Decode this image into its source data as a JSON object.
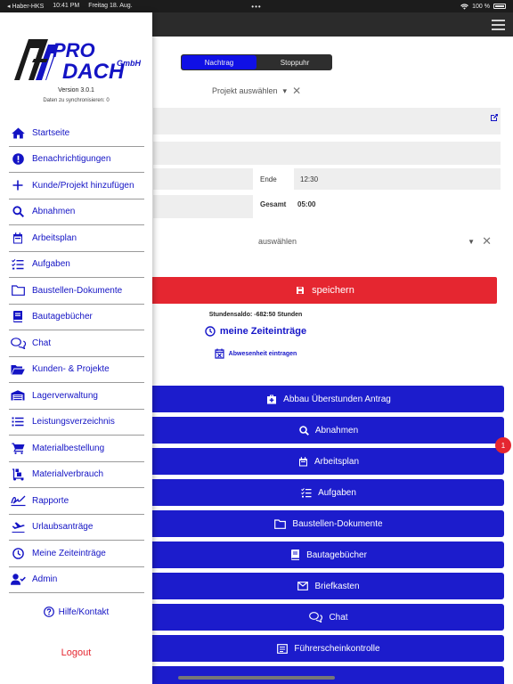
{
  "status": {
    "carrier": "◂ Haber-HKS",
    "time": "10:41 PM",
    "date": "Freitag 18. Aug.",
    "dots": "•••",
    "battery": "100 %"
  },
  "main": {
    "segment": {
      "tab1": "Nachtrag",
      "tab2": "Stoppuhr"
    },
    "project_select": "Projekt auswählen",
    "ende_label": "Ende",
    "ende_value": "12:30",
    "gesamt_label": "Gesamt",
    "gesamt_value": "05:00",
    "select_placeholder": "auswählen",
    "save_label": "speichern",
    "saldo": "Stundensaldo: -682:50 Stunden",
    "zeiteintraege": "meine Zeiteinträge",
    "abwesenheit": "Abwesenheit eintragen",
    "buttons": [
      {
        "label": "Abbau Überstunden Antrag",
        "icon": "medkit-icon"
      },
      {
        "label": "Abnahmen",
        "icon": "search-icon"
      },
      {
        "label": "Arbeitsplan",
        "icon": "calendar-icon"
      },
      {
        "label": "Aufgaben",
        "icon": "checklist-icon"
      },
      {
        "label": "Baustellen-Dokumente",
        "icon": "folder-icon"
      },
      {
        "label": "Bautagebücher",
        "icon": "book-icon"
      },
      {
        "label": "Briefkasten",
        "icon": "mail-icon"
      },
      {
        "label": "Chat",
        "icon": "chat-icon"
      },
      {
        "label": "Führerscheinkontrolle",
        "icon": "id-card-icon"
      }
    ],
    "badge": "1"
  },
  "drawer": {
    "version": "Version 3.0.1",
    "sync": "Daten zu synchronisieren: 0",
    "items": [
      {
        "label": "Startseite",
        "icon": "home-icon"
      },
      {
        "label": "Benachrichtigungen",
        "icon": "alert-icon"
      },
      {
        "label": "Kunde/Projekt hinzufügen",
        "icon": "plus-icon"
      },
      {
        "label": "Abnahmen",
        "icon": "search-icon"
      },
      {
        "label": "Arbeitsplan",
        "icon": "calendar-icon"
      },
      {
        "label": "Aufgaben",
        "icon": "checklist-icon"
      },
      {
        "label": "Baustellen-Dokumente",
        "icon": "folder-icon"
      },
      {
        "label": "Bautagebücher",
        "icon": "book-icon"
      },
      {
        "label": "Chat",
        "icon": "chat-icon"
      },
      {
        "label": "Kunden- & Projekte",
        "icon": "folder-open-icon"
      },
      {
        "label": "Lagerverwaltung",
        "icon": "warehouse-icon"
      },
      {
        "label": "Leistungsverzeichnis",
        "icon": "list-icon"
      },
      {
        "label": "Materialbestellung",
        "icon": "cart-icon"
      },
      {
        "label": "Materialverbrauch",
        "icon": "dolly-icon"
      },
      {
        "label": "Rapporte",
        "icon": "signature-icon"
      },
      {
        "label": "Urlaubsanträge",
        "icon": "plane-icon"
      },
      {
        "label": "Meine Zeiteinträge",
        "icon": "clock-icon"
      },
      {
        "label": "Admin",
        "icon": "user-check-icon"
      }
    ],
    "help": "Hilfe/Kontakt",
    "logout": "Logout"
  }
}
